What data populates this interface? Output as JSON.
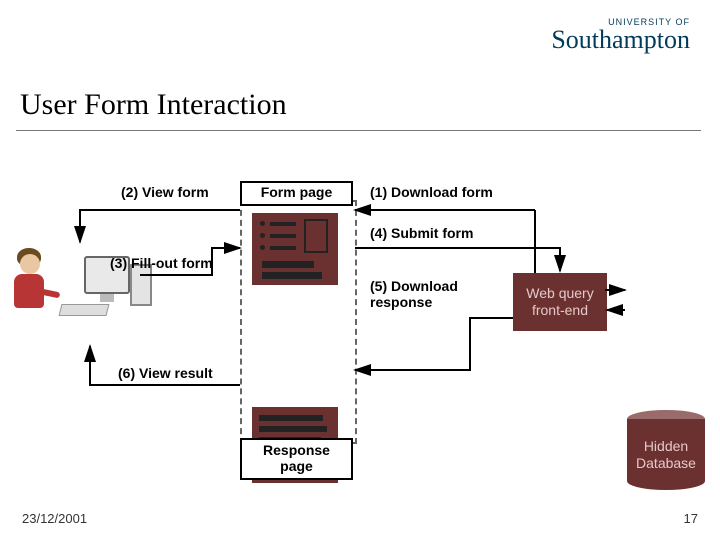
{
  "logo": {
    "tag": "UNIVERSITY OF",
    "name": "Southampton"
  },
  "title": "User Form Interaction",
  "boxes": {
    "form_page": "Form page",
    "response_page": "Response\npage",
    "web_query": "Web query\nfront-end",
    "hidden_db": "Hidden\nDatabase"
  },
  "steps": {
    "s1": "(1) Download form",
    "s2": "(2) View form",
    "s3": "(3) Fill-out form",
    "s4": "(4) Submit form",
    "s5": "(5) Download\nresponse",
    "s6": "(6) View result"
  },
  "date": "23/12/2001",
  "page_number": "17"
}
